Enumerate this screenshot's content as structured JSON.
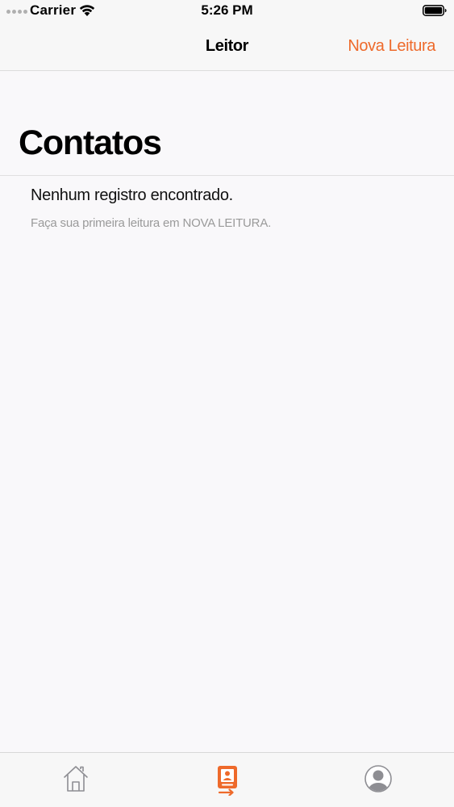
{
  "status_bar": {
    "carrier": "Carrier",
    "time": "5:26 PM",
    "icons": [
      "signal-dots-icon",
      "wifi-icon",
      "battery-icon"
    ]
  },
  "nav_bar": {
    "title": "Leitor",
    "action_label": "Nova Leitura"
  },
  "page": {
    "large_title": "Contatos",
    "empty_title": "Nenhum registro encontrado.",
    "empty_subtitle": "Faça sua primeira leitura em NOVA LEITURA."
  },
  "tab_bar": {
    "tabs": [
      {
        "icon": "home-icon",
        "selected": false
      },
      {
        "icon": "badge-reader-icon",
        "selected": true
      },
      {
        "icon": "profile-icon",
        "selected": false
      }
    ]
  },
  "colors": {
    "accent": "#ee6a2b",
    "background": "#f9f8fa",
    "bar_background": "#f7f7f7",
    "secondary_text": "#9a9a9a",
    "inactive_icon": "#8e8e93"
  }
}
